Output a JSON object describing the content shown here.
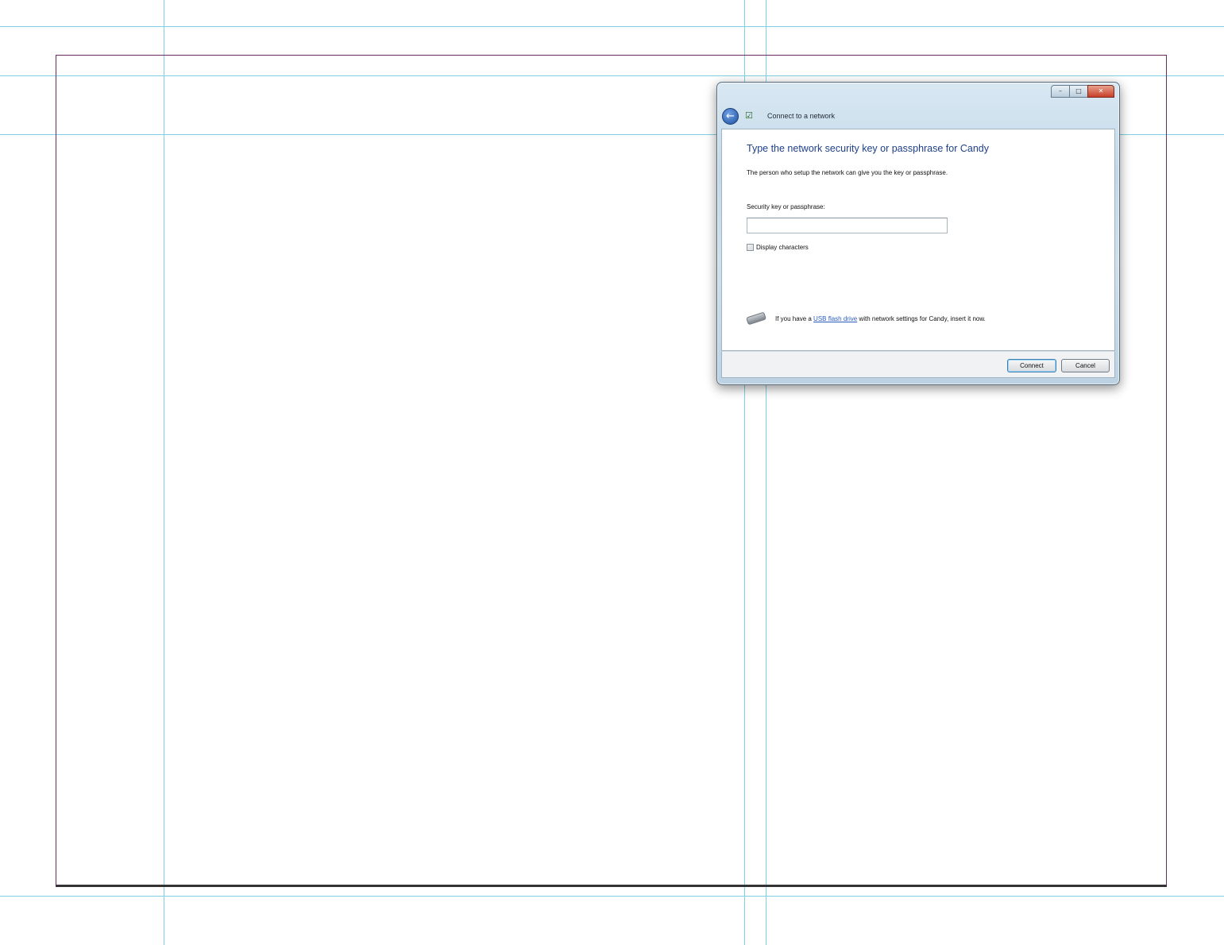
{
  "dialog": {
    "title": "Connect to a network",
    "title_buttons": [
      "minimize",
      "maximize",
      "close"
    ],
    "heading": "Type the network security key or passphrase for Candy",
    "description": "The person who setup the network can give you the key or passphrase.",
    "key_label": "Security key or passphrase:",
    "key_value": "",
    "display_characters_label": "Display characters",
    "display_characters_checked": false,
    "usb": {
      "prefix": "If you have a",
      "link": "USB flash drive",
      "suffix": "with network settings for Candy, insert it now."
    },
    "buttons": {
      "connect": "Connect",
      "cancel": "Cancel"
    }
  },
  "colors": {
    "heading": "#1e3f8a",
    "link": "#2a5cc0",
    "guide": "#7fd0e6",
    "frame": "#6a2a63"
  }
}
